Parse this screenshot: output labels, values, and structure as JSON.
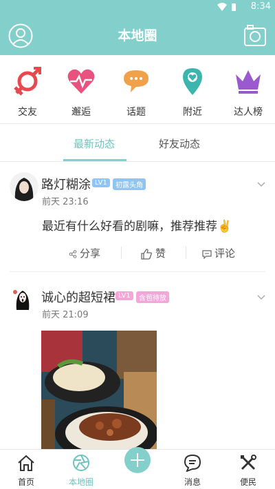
{
  "status_bar": {
    "time": "8:34"
  },
  "header": {
    "title": "本地圈",
    "left_icon": "user-avatar-icon",
    "right_icon": "camera-icon"
  },
  "categories": [
    {
      "label": "交友",
      "icon": "gender-icon",
      "color": "#e8484f"
    },
    {
      "label": "邂逅",
      "icon": "heartbeat-icon",
      "color": "#e9527e"
    },
    {
      "label": "话题",
      "icon": "chat-bubble-icon",
      "color": "#f0a14a"
    },
    {
      "label": "附近",
      "icon": "location-pin-icon",
      "color": "#3bb5ae"
    },
    {
      "label": "达人榜",
      "icon": "crown-icon",
      "color": "#9b59d0"
    }
  ],
  "tabs": [
    {
      "label": "最新动态",
      "active": true
    },
    {
      "label": "好友动态",
      "active": false
    }
  ],
  "posts": [
    {
      "username": "路灯糊涂",
      "level": "LV1",
      "tag": "初露头角",
      "time": "前天 23:16",
      "text": "最近有什么好看的剧嘛，推荐推荐✌️",
      "actions": {
        "share": "分享",
        "like": "赞",
        "comment": "评论"
      }
    },
    {
      "username": "诚心的超短裙",
      "level": "LV1",
      "tag": "含苞待放",
      "time": "前天 21:09"
    }
  ],
  "bottom_nav": [
    {
      "label": "首页",
      "icon": "home-icon",
      "active": false
    },
    {
      "label": "本地圈",
      "icon": "aperture-icon",
      "active": true
    },
    {
      "label": "",
      "icon": "plus-icon",
      "active": false
    },
    {
      "label": "消息",
      "icon": "message-icon",
      "active": false
    },
    {
      "label": "便民",
      "icon": "tools-icon",
      "active": false
    }
  ],
  "colors": {
    "accent": "#83cfcb",
    "accent_text": "#6cc4bf",
    "level_badge": "#8ec5f5",
    "tag_badge_1": "#8ec5f5",
    "tag_badge_2": "#f3a6d8"
  }
}
